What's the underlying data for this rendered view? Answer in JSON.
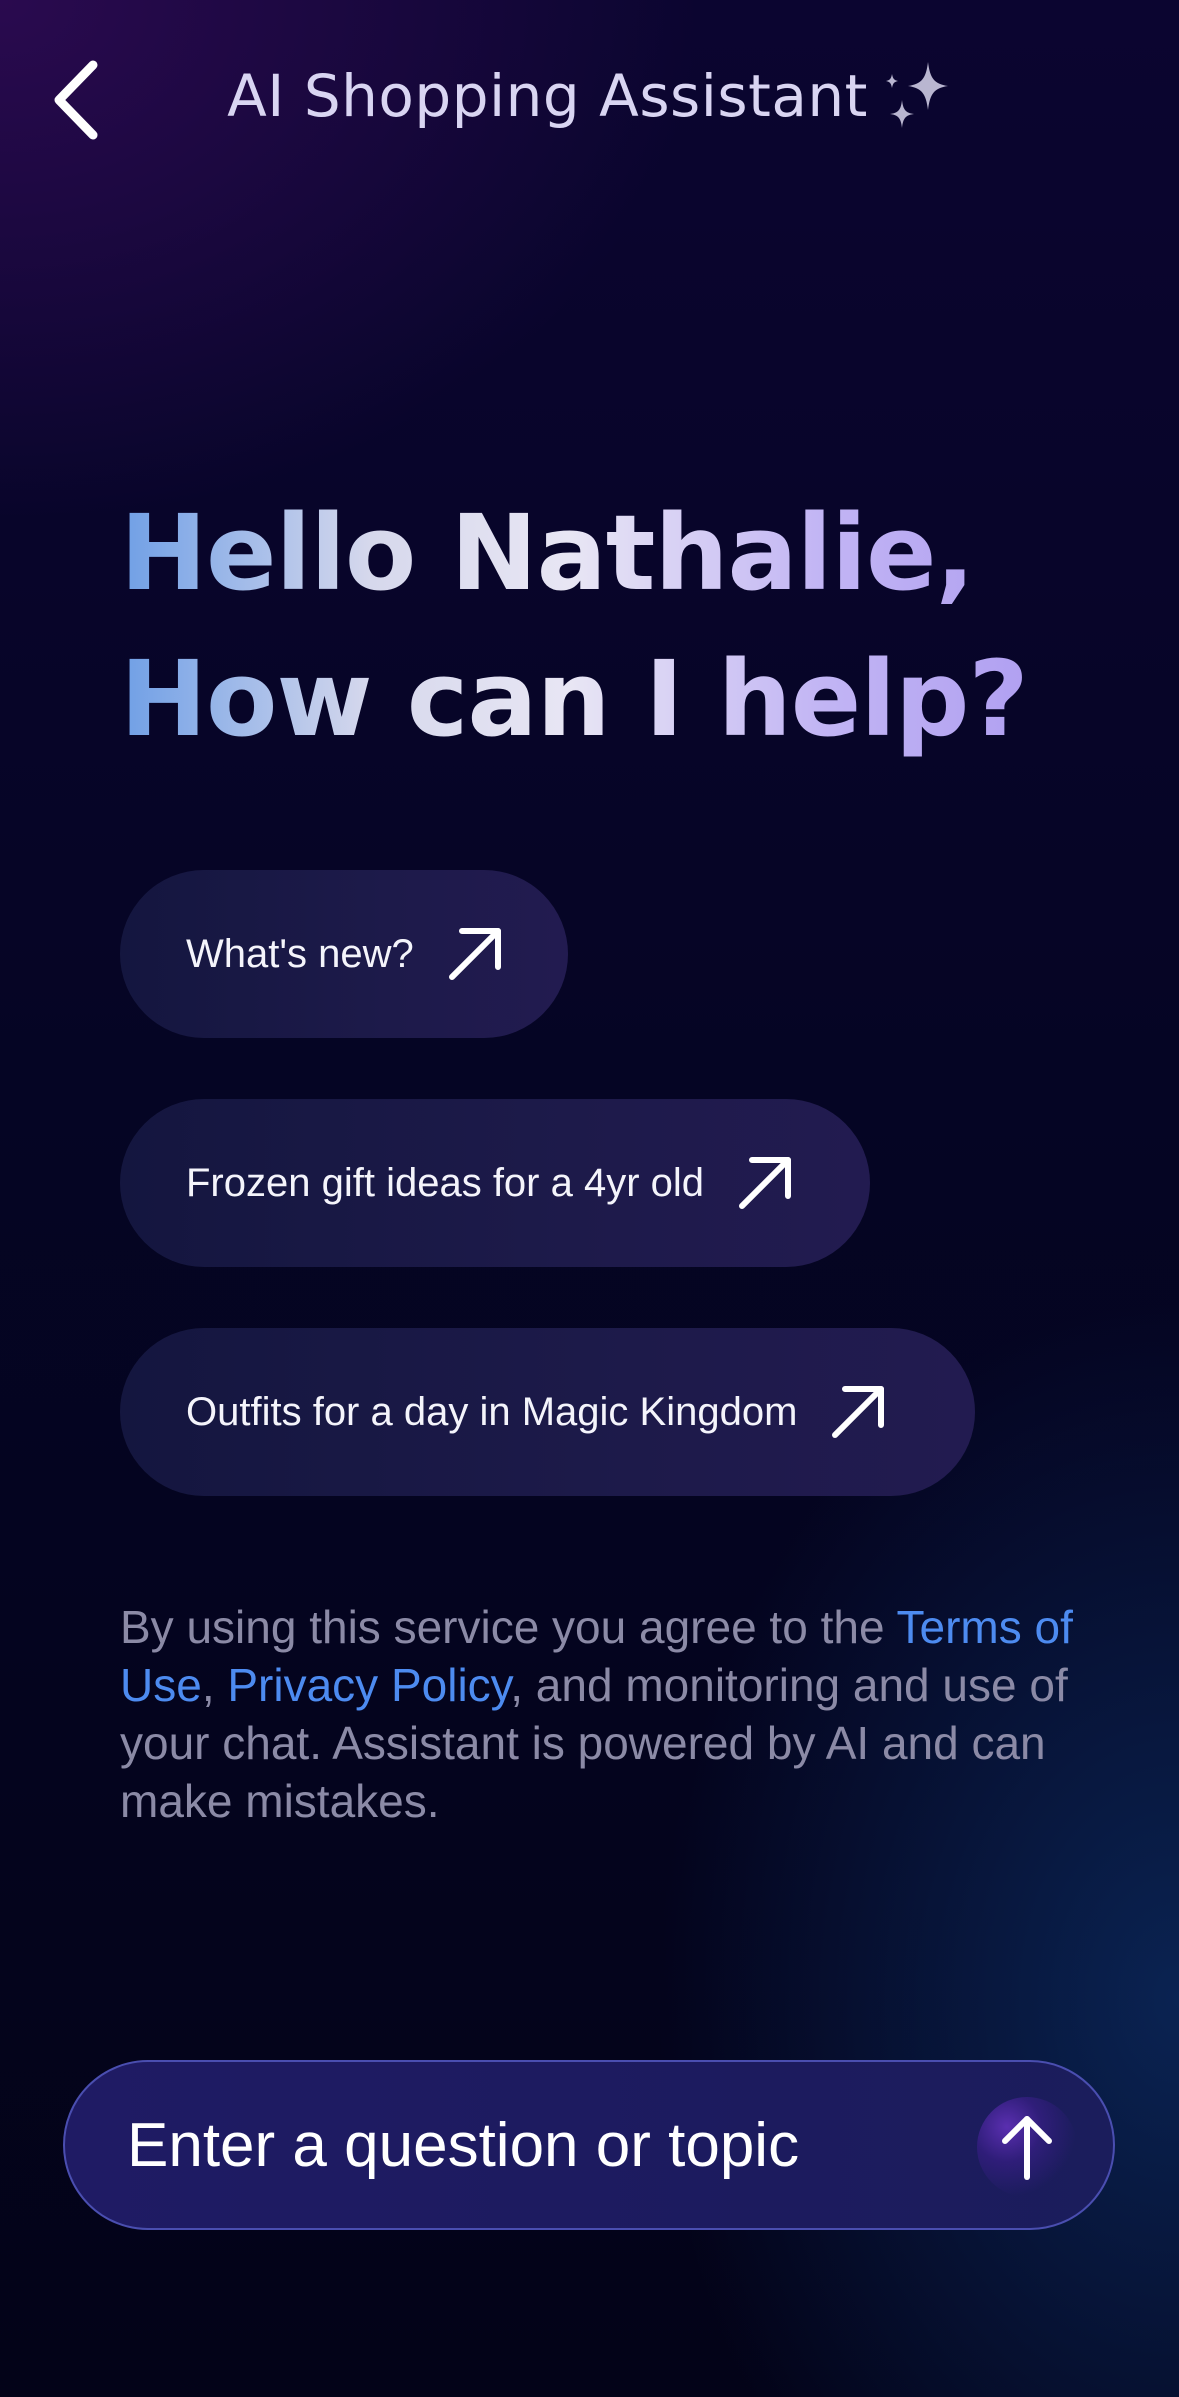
{
  "header": {
    "back_icon": "chevron-left-icon",
    "title": "AI Shopping Assistant",
    "title_icon": "sparkles-icon"
  },
  "greeting": {
    "line1": "Hello Nathalie,",
    "line2": "How can I help?"
  },
  "suggestions": [
    {
      "label": "What's new?",
      "icon": "arrow-up-right-icon"
    },
    {
      "label": "Frozen gift ideas for a 4yr old",
      "icon": "arrow-up-right-icon"
    },
    {
      "label": "Outfits for a day in Magic Kingdom",
      "icon": "arrow-up-right-icon"
    }
  ],
  "disclaimer": {
    "prefix": "By using this service you agree to the ",
    "terms_link": "Terms of Use",
    "separator": ", ",
    "privacy_link": "Privacy Policy",
    "suffix": ", and monitoring and use of your chat. Assistant is powered by AI and can make mistakes."
  },
  "input": {
    "placeholder": "Enter a question or topic",
    "send_icon": "arrow-up-icon"
  },
  "colors": {
    "link": "#4d8bf0",
    "disclaimer_text": "#8b8aa6",
    "input_border": "#4a4eb0",
    "greeting_gradient_start": "#6f9fe6",
    "greeting_gradient_end": "#a997f0"
  }
}
